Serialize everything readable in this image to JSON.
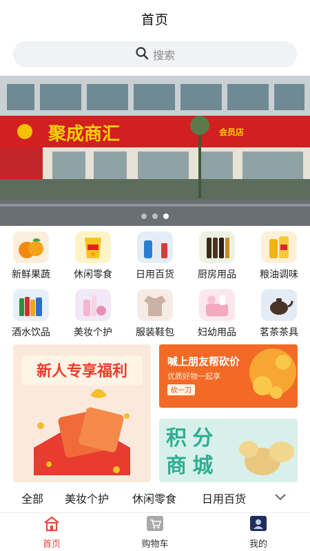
{
  "header": {
    "title": "首页"
  },
  "search": {
    "placeholder": "搜索",
    "icon": "search-icon"
  },
  "banner": {
    "store_name": "聚成商汇",
    "store_tag": "会员店",
    "dots": 3,
    "active_dot": 3
  },
  "categories": [
    {
      "label": "新鲜果蔬",
      "icon": "orange-fruit-icon"
    },
    {
      "label": "休闲零食",
      "icon": "snack-bag-icon"
    },
    {
      "label": "日用百货",
      "icon": "daily-goods-icon"
    },
    {
      "label": "厨房用品",
      "icon": "kitchen-bottles-icon"
    },
    {
      "label": "粮油调味",
      "icon": "cooking-oil-icon"
    },
    {
      "label": "酒水饮品",
      "icon": "beverages-icon"
    },
    {
      "label": "美妆个护",
      "icon": "cosmetics-icon"
    },
    {
      "label": "服装鞋包",
      "icon": "clothing-icon"
    },
    {
      "label": "妇幼用品",
      "icon": "baby-products-icon"
    },
    {
      "label": "茗茶茶具",
      "icon": "teapot-icon"
    }
  ],
  "promos": {
    "newcomer": {
      "title": "新人专享福利"
    },
    "bargain": {
      "title": "喊上朋友帮砍价",
      "subtitle": "优质好物一起享",
      "button": "砍一刀"
    },
    "points": {
      "line1": "积 分",
      "line2": "商 城"
    }
  },
  "filter_tabs": [
    "全部",
    "美妆个护",
    "休闲零食",
    "日用百货"
  ],
  "bottom_nav": [
    {
      "label": "首页",
      "icon": "home-icon",
      "active": true
    },
    {
      "label": "购物车",
      "icon": "cart-icon",
      "active": false
    },
    {
      "label": "我的",
      "icon": "profile-icon",
      "active": false
    }
  ],
  "colors": {
    "accent": "#e8463c",
    "promo_orange": "#f0551f",
    "promo_green": "#2fae93"
  }
}
